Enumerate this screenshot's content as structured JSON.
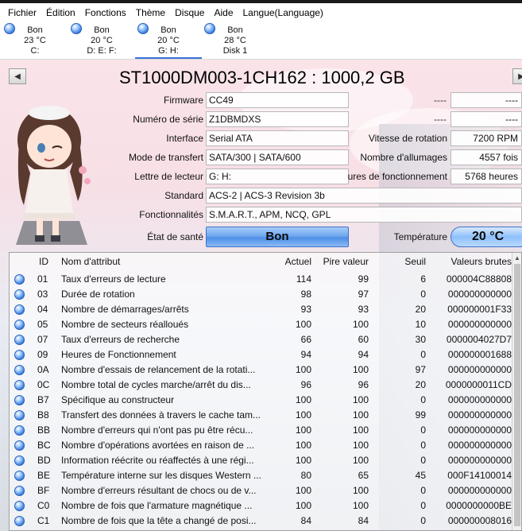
{
  "menu": [
    "Fichier",
    "Édition",
    "Fonctions",
    "Thème",
    "Disque",
    "Aide",
    "Langue(Language)"
  ],
  "disks": [
    {
      "status": "Bon",
      "temp": "23 °C",
      "label": "C:"
    },
    {
      "status": "Bon",
      "temp": "20 °C",
      "label": "D: E: F:"
    },
    {
      "status": "Bon",
      "temp": "20 °C",
      "label": "G: H:"
    },
    {
      "status": "Bon",
      "temp": "28 °C",
      "label": "Disk 1"
    }
  ],
  "title": "ST1000DM003-1CH162 : 1000,2 GB",
  "info": {
    "firmware_label": "Firmware",
    "firmware": "CC49",
    "serial_label": "Numéro de série",
    "serial": "Z1DBMDXS",
    "interface_label": "Interface",
    "interface": "Serial ATA",
    "transfer_label": "Mode de transfert",
    "transfer": "SATA/300 | SATA/600",
    "drive_label": "Lettre de lecteur",
    "drive": "G: H:",
    "standard_label": "Standard",
    "standard": "ACS-2 | ACS-3 Revision 3b",
    "features_label": "Fonctionnalités",
    "features": "S.M.A.R.T., APM, NCQ, GPL",
    "health_label": "État de santé",
    "health": "Bon",
    "temp_label": "Température",
    "temp": "20 °C",
    "dash1": "----",
    "dash1_val": "----",
    "dash2": "----",
    "dash2_val": "----",
    "rotation_label": "Vitesse de rotation",
    "rotation": "7200 RPM",
    "poweron_count_label": "Nombre d'allumages",
    "poweron_count": "4557 fois",
    "poweron_hours_label": "ures de fonctionnement",
    "poweron_hours": "5768 heures"
  },
  "columns": [
    "ID",
    "Nom d'attribut",
    "Actuel",
    "Pire valeur",
    "Seuil",
    "Valeurs brutes"
  ],
  "rows": [
    [
      "01",
      "Taux d'erreurs de lecture",
      "114",
      "99",
      "6",
      "000004C88808"
    ],
    [
      "03",
      "Durée de rotation",
      "98",
      "97",
      "0",
      "000000000000"
    ],
    [
      "04",
      "Nombre de démarrages/arrêts",
      "93",
      "93",
      "20",
      "000000001F33"
    ],
    [
      "05",
      "Nombre de secteurs réalloués",
      "100",
      "100",
      "10",
      "000000000000"
    ],
    [
      "07",
      "Taux d'erreurs de recherche",
      "66",
      "60",
      "30",
      "0000004027D7"
    ],
    [
      "09",
      "Heures de Fonctionnement",
      "94",
      "94",
      "0",
      "000000001688"
    ],
    [
      "0A",
      "Nombre d'essais de relancement de la rotati...",
      "100",
      "100",
      "97",
      "000000000000"
    ],
    [
      "0C",
      "Nombre total de cycles marche/arrêt du dis...",
      "96",
      "96",
      "20",
      "0000000011CD"
    ],
    [
      "B7",
      "Spécifique au constructeur",
      "100",
      "100",
      "0",
      "000000000000"
    ],
    [
      "B8",
      "Transfert des données à travers le cache tam...",
      "100",
      "100",
      "99",
      "000000000000"
    ],
    [
      "BB",
      "Nombre d'erreurs qui n'ont pas pu être récu...",
      "100",
      "100",
      "0",
      "000000000000"
    ],
    [
      "BC",
      "Nombre d'opérations avortées en raison de ...",
      "100",
      "100",
      "0",
      "000000000000"
    ],
    [
      "BD",
      "Information réécrite ou réaffectés à une régi...",
      "100",
      "100",
      "0",
      "000000000000"
    ],
    [
      "BE",
      "Température interne sur les disques Western ...",
      "80",
      "65",
      "45",
      "000F14100014"
    ],
    [
      "BF",
      "Nombre d'erreurs résultant de chocs ou de v...",
      "100",
      "100",
      "0",
      "000000000000"
    ],
    [
      "C0",
      "Nombre de fois que l'armature magnétique ...",
      "100",
      "100",
      "0",
      "0000000000BE"
    ],
    [
      "C1",
      "Nombre de fois que la tête a changé de posi...",
      "84",
      "84",
      "0",
      "000000008016"
    ]
  ]
}
